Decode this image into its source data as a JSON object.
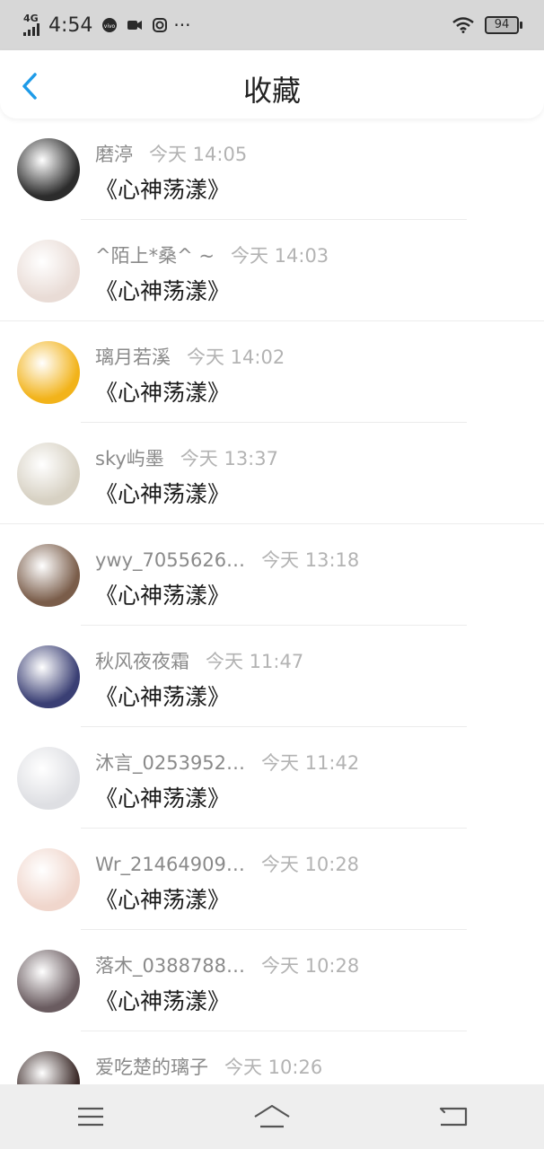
{
  "status": {
    "network": "4G",
    "time": "4:54",
    "battery": "94"
  },
  "header": {
    "title": "收藏"
  },
  "items": [
    {
      "user": "磨渟",
      "time": "今天 14:05",
      "text": "《心神荡漾》",
      "avatar_color": "#2c2c2c"
    },
    {
      "user": "^陌上*桑^ ~",
      "time": "今天 14:03",
      "text": "《心神荡漾》",
      "avatar_color": "#e9dcd6"
    },
    {
      "user": "璃月若溪",
      "time": "今天 14:02",
      "text": "《心神荡漾》",
      "avatar_color": "#f2b31a"
    },
    {
      "user": "sky屿墨",
      "time": "今天 13:37",
      "text": "《心神荡漾》",
      "avatar_color": "#d7d1c3"
    },
    {
      "user": "ywy_7055626…",
      "time": "今天 13:18",
      "text": "《心神荡漾》",
      "avatar_color": "#7a5d4a"
    },
    {
      "user": "秋风夜夜霜",
      "time": "今天 11:47",
      "text": "《心神荡漾》",
      "avatar_color": "#3a3f74"
    },
    {
      "user": "沐言_0253952…",
      "time": "今天 11:42",
      "text": "《心神荡漾》",
      "avatar_color": "#dedfe3"
    },
    {
      "user": "Wr_21464909…",
      "time": "今天 10:28",
      "text": "《心神荡漾》",
      "avatar_color": "#f0d6cc"
    },
    {
      "user": "落木_0388788…",
      "time": "今天 10:28",
      "text": "《心神荡漾》",
      "avatar_color": "#6a5c60"
    },
    {
      "user": "爱吃楚的璃子",
      "time": "今天 10:26",
      "text": "",
      "avatar_color": "#3b2a28"
    }
  ],
  "colors": {
    "accent": "#1e9be8",
    "statusbar": "#d7d7d7",
    "navbar": "#eeeeee"
  },
  "icons": {
    "back": "chevron-left-icon",
    "menu": "menu-icon",
    "home": "home-icon",
    "return": "return-icon"
  }
}
